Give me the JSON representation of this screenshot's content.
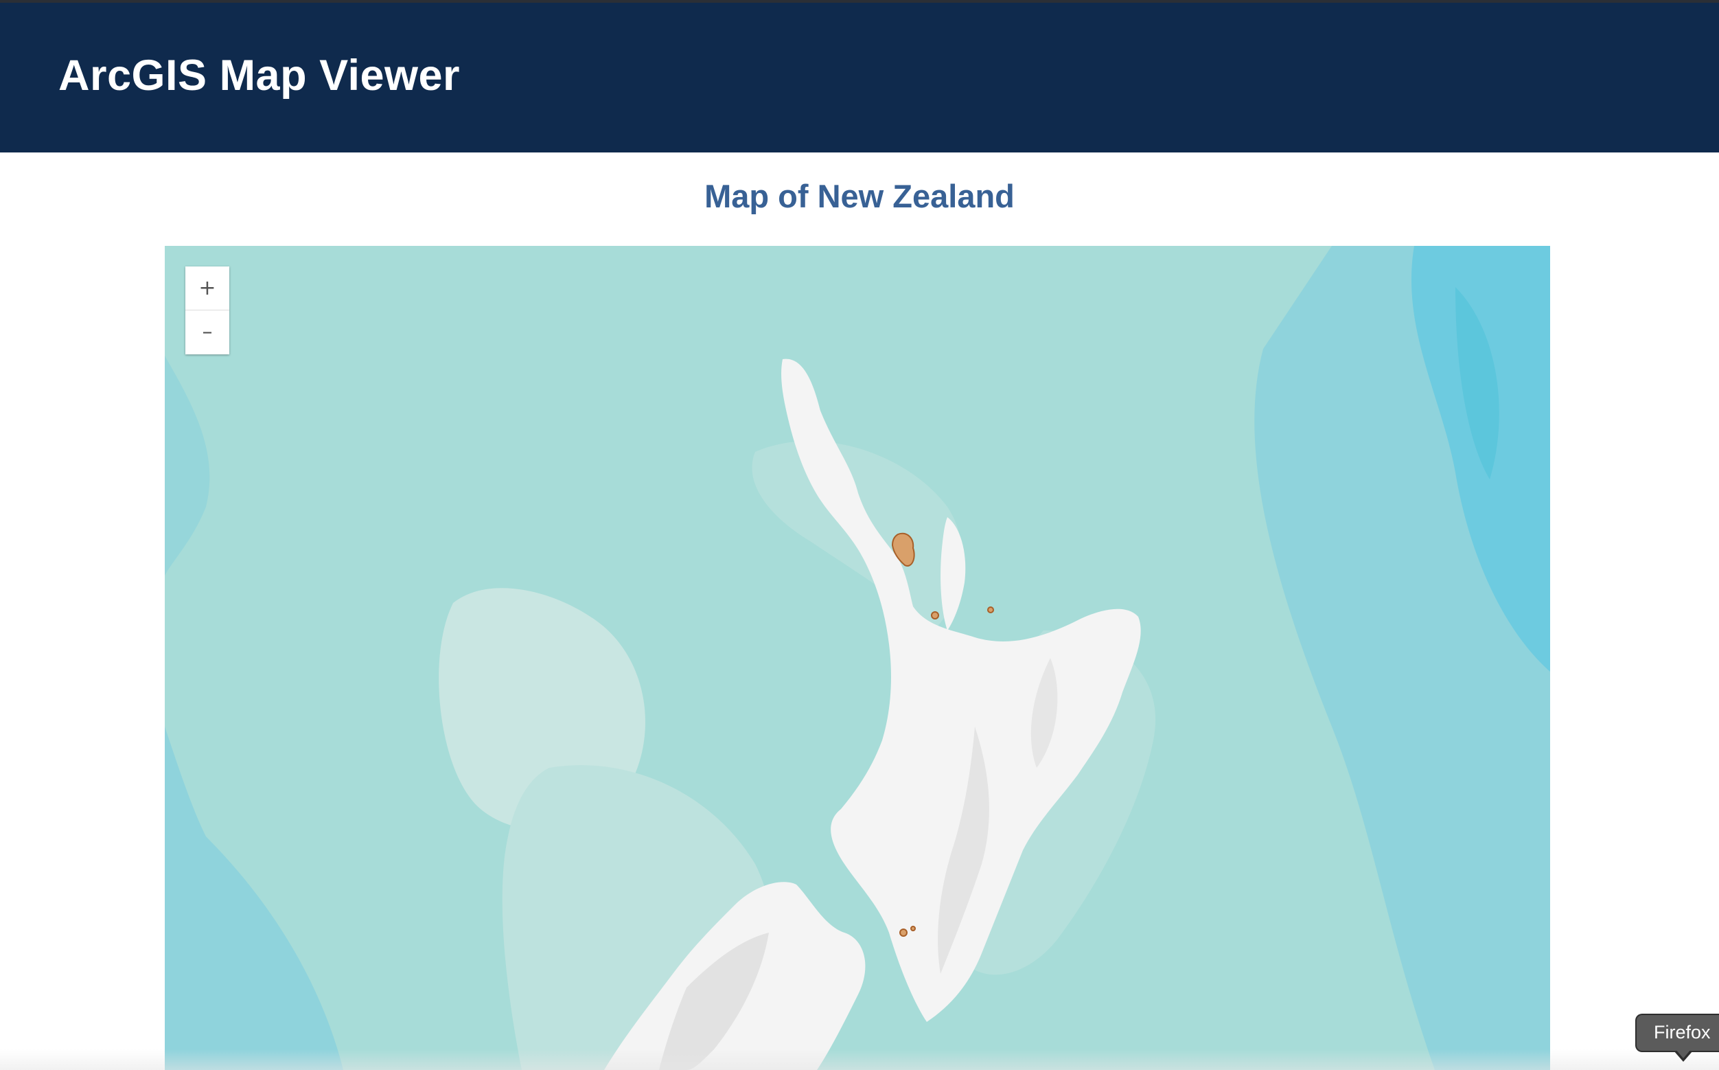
{
  "header": {
    "app_title": "ArcGIS Map Viewer",
    "background_color": "#0f2a4d"
  },
  "page": {
    "map_title": "Map of New Zealand",
    "map_title_color": "#386195"
  },
  "map": {
    "region": "New Zealand",
    "basemap_colors": {
      "ocean_deep": "#5cc6dc",
      "ocean_mid": "#a7dcd8",
      "ocean_shelf": "#c9e6e2",
      "land": "#f4f4f4",
      "feature_highlight": "#c98a4a"
    },
    "zoom_controls": {
      "zoom_in_label": "+",
      "zoom_out_label": "–",
      "zoom_in_icon": "plus-icon",
      "zoom_out_icon": "minus-icon"
    }
  },
  "tooltip": {
    "text": "Firefox"
  }
}
